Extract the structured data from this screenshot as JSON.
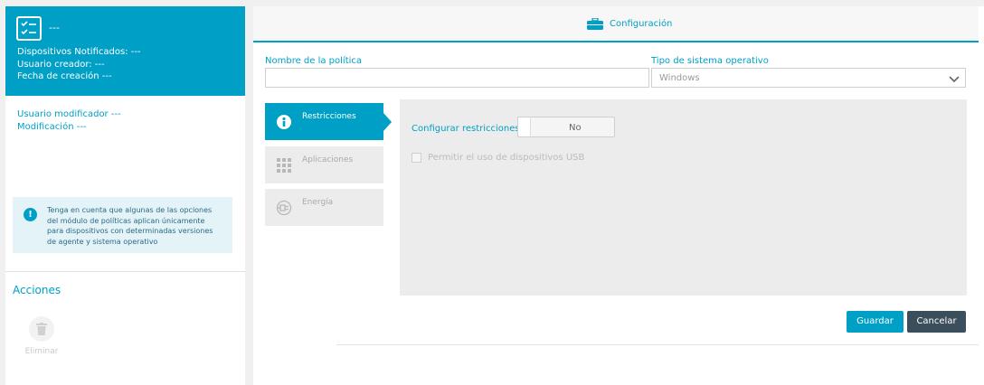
{
  "policy": {
    "title": "---",
    "notified_devices": "Dispositivos Notificados: ---",
    "creator": "Usuario creador: ---",
    "creation_date": "Fecha de creación ---",
    "modifier": "Usuario modificador ---",
    "modification": "Modificación ---",
    "info_text": "Tenga en cuenta que algunas de las opciones del módulo de políticas aplican únicamente para dispositivos con determinadas versiones de agente y sistema operativo",
    "actions_heading": "Acciones",
    "delete_label": "Eliminar"
  },
  "config": {
    "header": "Configuración",
    "policy_name_label": "Nombre de la política",
    "policy_name_value": "",
    "os_type_label": "Tipo de sistema operativo",
    "os_type_value": "Windows",
    "nav": [
      {
        "label": "Restricciones",
        "icon": "info-icon",
        "active": true
      },
      {
        "label": "Aplicaciones",
        "icon": "apps-grid-icon",
        "active": false
      },
      {
        "label": "Energía",
        "icon": "power-plug-icon",
        "active": false
      }
    ],
    "configure_restrictions_label": "Configurar restricciones",
    "configure_restrictions_value": "No",
    "usb_label": "Permitir el uso de dispositivos USB",
    "usb_checked": false,
    "save_label": "Guardar",
    "cancel_label": "Cancelar"
  },
  "colors": {
    "accent": "#00a0c6",
    "dark_button": "#3b4e5c"
  }
}
